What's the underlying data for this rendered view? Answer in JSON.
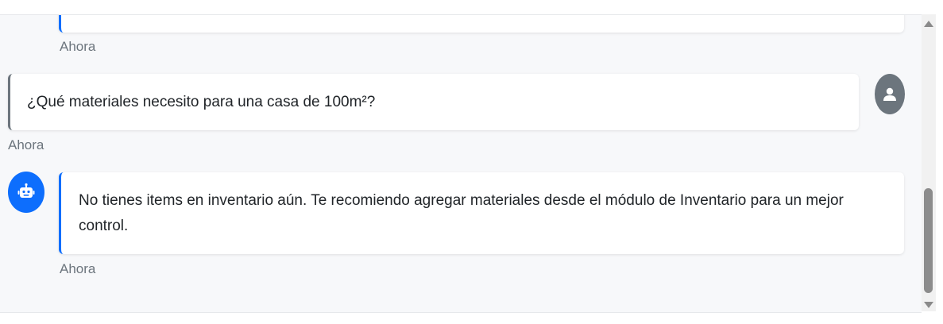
{
  "messages": [
    {
      "role": "bot",
      "text": "",
      "timestamp": "Ahora"
    },
    {
      "role": "user",
      "text": "¿Qué materiales necesito para una casa de 100m²?",
      "timestamp": "Ahora"
    },
    {
      "role": "bot",
      "text": "No tienes items en inventario aún. Te recomiendo agregar materiales desde el módulo de Inventario para un mejor control.",
      "timestamp": "Ahora"
    }
  ],
  "icons": {
    "user_avatar": "user-icon",
    "bot_avatar": "robot-icon"
  },
  "colors": {
    "bot_accent": "#0d6efd",
    "user_accent": "#6c757d",
    "panel_background": "#f7f8fa"
  }
}
